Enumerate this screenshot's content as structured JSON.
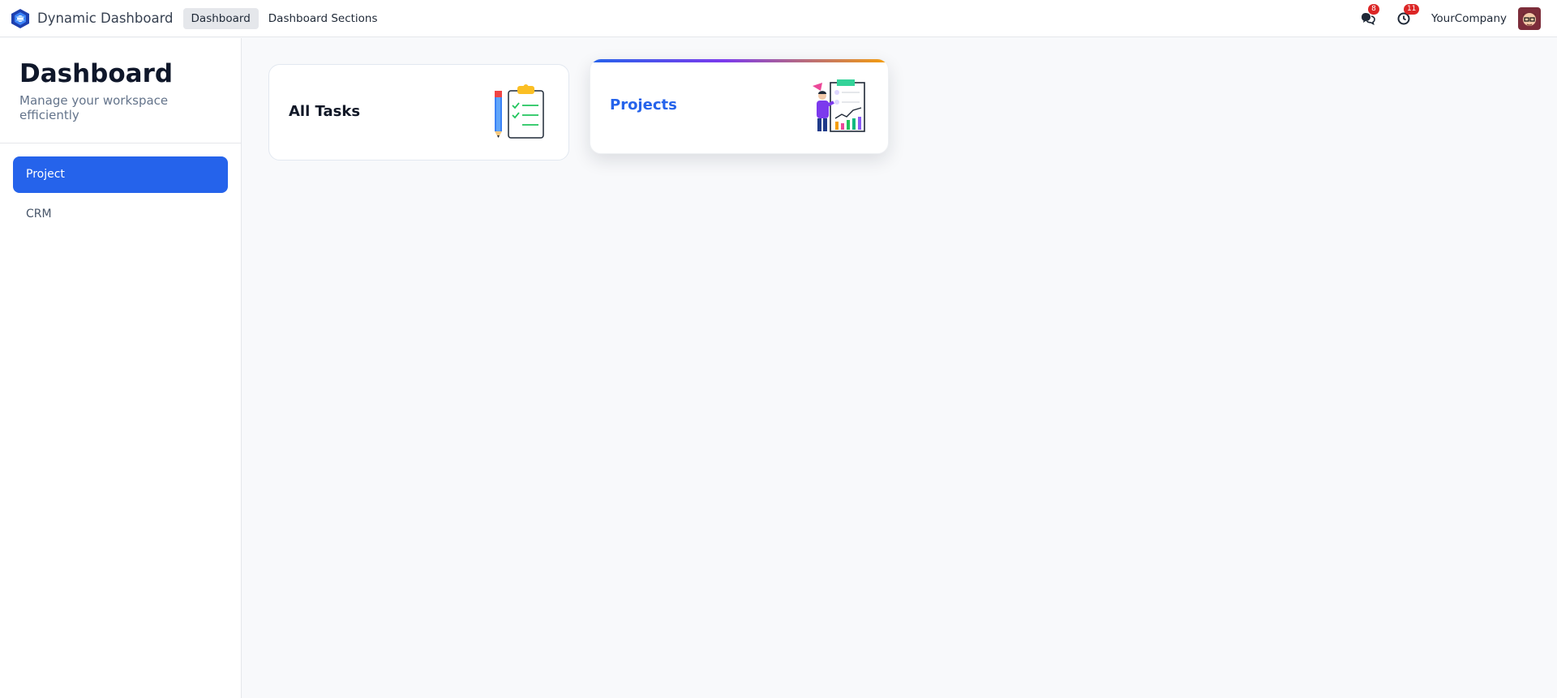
{
  "app": {
    "name": "Dynamic Dashboard",
    "menu": [
      {
        "label": "Dashboard",
        "active": true
      },
      {
        "label": "Dashboard Sections",
        "active": false
      }
    ],
    "systray": {
      "messages_count": "8",
      "activities_count": "11",
      "company": "YourCompany"
    }
  },
  "sidebar": {
    "title": "Dashboard",
    "subtitle": "Manage your workspace efficiently",
    "items": [
      {
        "label": "Project",
        "active": true
      },
      {
        "label": "CRM",
        "active": false
      }
    ]
  },
  "cards": [
    {
      "title": "All Tasks",
      "icon": "clipboard-checklist-icon"
    },
    {
      "title": "Projects",
      "icon": "presentation-chart-icon"
    }
  ],
  "colors": {
    "accent": "#2563eb",
    "badge": "#dc2626",
    "gradient_end": "#f59e0b"
  }
}
